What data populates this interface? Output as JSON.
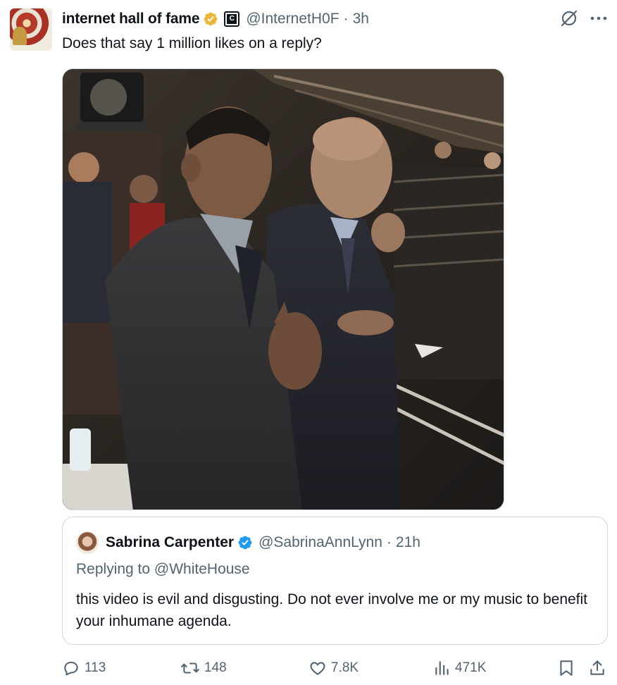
{
  "tweet": {
    "display_name": "internet hall of fame",
    "handle": "@InternetH0F",
    "separator": "·",
    "time": "3h",
    "affiliate_badge_letter": "C",
    "text": "Does that say 1 million likes on a reply?",
    "verified_color": "#e8b83a",
    "icons": [
      "verified-gold-icon",
      "affiliate-badge-icon",
      "grok-icon",
      "more-icon"
    ]
  },
  "media": {
    "kind": "photo",
    "subjects": "two men in dark suits standing courtside, one with hand on chest, one with hand at mouth"
  },
  "quote": {
    "display_name": "Sabrina Carpenter",
    "handle": "@SabrinaAnnLynn",
    "separator": "·",
    "time": "21h",
    "replying_prefix": "Replying to",
    "replying_to": "@WhiteHouse",
    "text": "this video is evil and disgusting. Do not ever involve me or my music to benefit your inhumane agenda.",
    "verified_color": "#1d9bf0"
  },
  "actions": {
    "replies": "113",
    "retweets": "148",
    "likes": "7.8K",
    "views": "471K",
    "icons": [
      "reply-icon",
      "retweet-icon",
      "like-icon",
      "views-icon",
      "bookmark-icon",
      "share-icon"
    ]
  },
  "colors": {
    "text_primary": "#0f1419",
    "text_secondary": "#536471",
    "border": "#cfd9de",
    "verified_blue": "#1d9bf0",
    "verified_gold": "#e8b83a"
  }
}
